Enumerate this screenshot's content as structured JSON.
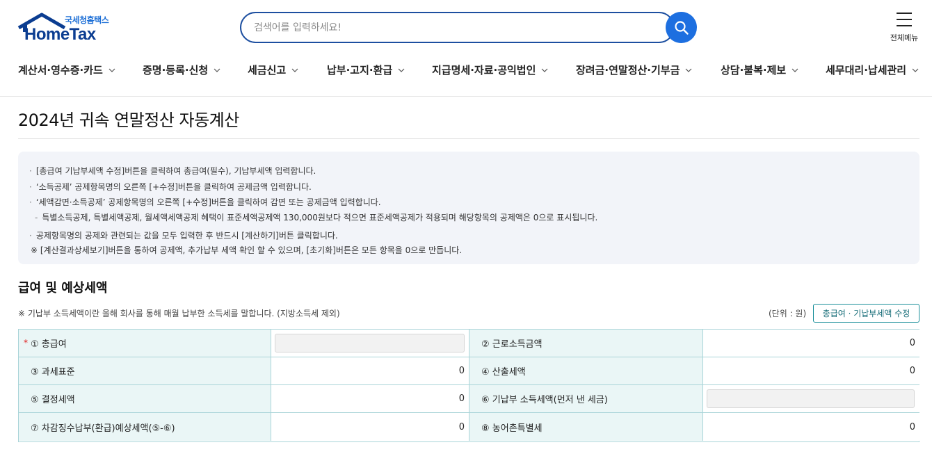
{
  "header": {
    "logo_small": "국세청홈택스",
    "logo_big": "HomeTax",
    "search_placeholder": "검색어를 입력하세요!",
    "all_menu_label": "전체메뉴"
  },
  "gnb": [
    {
      "label": "계산서·영수증·카드"
    },
    {
      "label": "증명·등록·신청"
    },
    {
      "label": "세금신고"
    },
    {
      "label": "납부·고지·환급"
    },
    {
      "label": "지급명세·자료·공익법인"
    },
    {
      "label": "장려금·연말정산·기부금"
    },
    {
      "label": "상담·불복·제보"
    },
    {
      "label": "세무대리·납세관리"
    }
  ],
  "page_title": "2024년 귀속 연말정산 자동계산",
  "info": {
    "lines": [
      "[총급여 기납부세액 수정]버튼을 클릭하여 총급여(필수), 기납부세액 입력합니다.",
      "‘소득공제’ 공제항목명의 오른쪽 [+수정]버튼을 클릭하여 공제금액 입력합니다.",
      "‘세액감면·소득공제’ 공제항목명의 오른쪽 [+수정]버튼을 클릭하여 감면 또는 공제금액 입력합니다.",
      "특별소득공제, 특별세액공제, 월세액세액공제 혜택이 표준세액공제액 130,000원보다 적으면 표준세액공제가 적용되며 해당항목의 공제액은 0으로 표시됩니다.",
      "공제항목명의 공제와 관련되는 값을 모두 입력한 후 반드시 [계산하기]버튼 클릭합니다.",
      "※ [계산결과상세보기]버튼을 통하여 공제액, 추가납부 세액 확인 할 수 있으며, [초기화]버튼은 모든 항목을 0으로 만듭니다."
    ]
  },
  "section": {
    "title": "급여 및 예상세액",
    "note": "※ 기납부 소득세액이란 올해 회사를 통해 매월 납부한 소득세를 말합니다. (지방소득세 제외)",
    "unit": "(단위 : 원)",
    "edit_button": "총급여 · 기납부세액 수정"
  },
  "table": {
    "required_mark": "*",
    "rows": [
      {
        "l_label": "① 총급여",
        "l_value": "",
        "r_label": "② 근로소득금액",
        "r_value": "0"
      },
      {
        "l_label": "③ 과세표준",
        "l_value": "0",
        "r_label": "④ 산출세액",
        "r_value": "0"
      },
      {
        "l_label": "⑤ 결정세액",
        "l_value": "0",
        "r_label": "⑥ 기납부 소득세액(먼저 낸 세금)",
        "r_value": ""
      },
      {
        "l_label": "⑦ 차감징수납부(환급)예상세액(⑤-⑥)",
        "l_value": "0",
        "r_label": "⑧ 농어촌특별세",
        "r_value": "0"
      }
    ]
  },
  "colors": {
    "brand": "#0b3d91",
    "search_border": "#1d4fa0",
    "search_button": "#1d6fe0",
    "table_border": "#a9d4d8",
    "table_header_bg": "#eaf6f6",
    "info_bg": "#f2f4f9",
    "required": "#e02020"
  },
  "icons": [
    "house-logo-icon",
    "search-icon",
    "hamburger-menu-icon",
    "chevron-down-icon"
  ]
}
